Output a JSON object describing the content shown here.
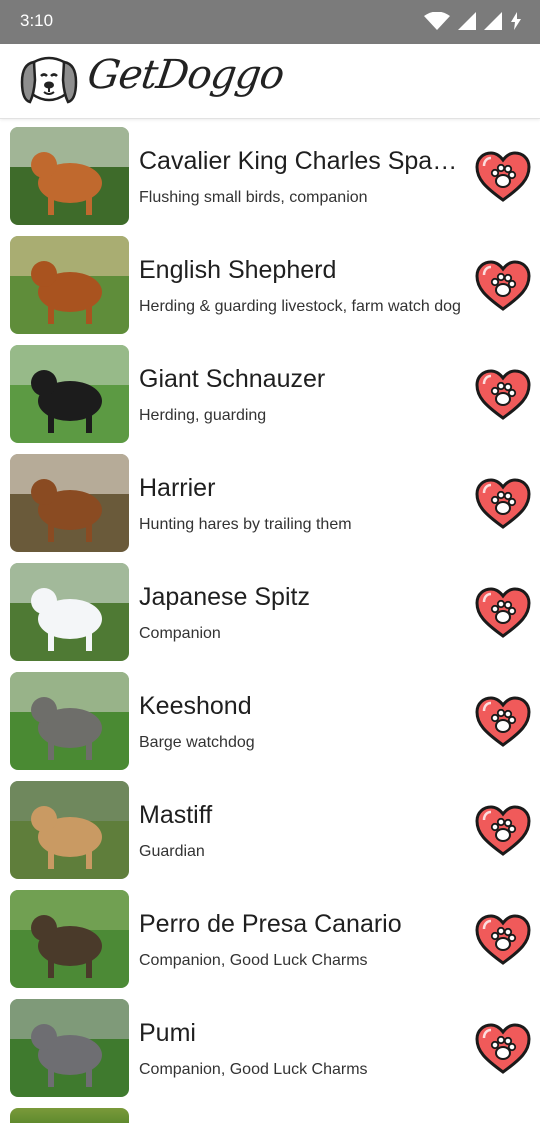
{
  "status_bar": {
    "time": "3:10"
  },
  "app": {
    "title": "GetDoggo"
  },
  "colors": {
    "favorite_fill": "#f05a5a",
    "favorite_stroke": "#1a1a1a"
  },
  "breeds": [
    {
      "name": "Cavalier King Charles Spaniel",
      "purpose": "Flushing small birds, companion",
      "photo_colors": [
        "#3e6b2a",
        "#c0692e",
        "#f2f2ee"
      ]
    },
    {
      "name": "English Shepherd",
      "purpose": "Herding & guarding livestock, farm watch dog",
      "photo_colors": [
        "#5f8d3a",
        "#a9531f",
        "#e6c9a0"
      ]
    },
    {
      "name": "Giant Schnauzer",
      "purpose": "Herding, guarding",
      "photo_colors": [
        "#5c9a43",
        "#1c1c1c",
        "#c8d6c2"
      ]
    },
    {
      "name": "Harrier",
      "purpose": "Hunting hares by trailing them",
      "photo_colors": [
        "#6a5a3a",
        "#8a4b22",
        "#f4efe6"
      ]
    },
    {
      "name": "Japanese Spitz",
      "purpose": "Companion",
      "photo_colors": [
        "#4f7a34",
        "#f4f6f8",
        "#e8ecef"
      ]
    },
    {
      "name": "Keeshond",
      "purpose": "Barge watchdog",
      "photo_colors": [
        "#4a8a33",
        "#6e6e6a",
        "#d9d6cf"
      ]
    },
    {
      "name": "Mastiff",
      "purpose": "Guardian",
      "photo_colors": [
        "#5f7e3b",
        "#c99a63",
        "#7b8f7a"
      ]
    },
    {
      "name": "Perro de Presa Canario",
      "purpose": "Companion, Good Luck Charms",
      "photo_colors": [
        "#4c8a36",
        "#4a3a2a",
        "#8fb36a"
      ]
    },
    {
      "name": "Pumi",
      "purpose": "Companion, Good Luck Charms",
      "photo_colors": [
        "#3f7a2e",
        "#6e6e72",
        "#b5b5b8"
      ]
    }
  ]
}
